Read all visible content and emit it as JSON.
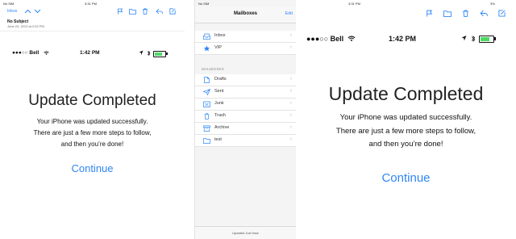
{
  "left_panel": {
    "status": {
      "carrier": "No SIM",
      "time": "3:31 PM"
    },
    "toolbar": {
      "back_label": "Inbox"
    },
    "message": {
      "subject": "No Subject",
      "date": "June 24, 2013 at 2:02 PM"
    },
    "device": {
      "carrier": "●●●○○ Bell",
      "time": "1:42 PM",
      "title": "Update Completed",
      "body_lines": [
        "Your iPhone was updated successfully.",
        "There are just a few more steps to follow,",
        "and then you’re done!"
      ],
      "continue_label": "Continue"
    }
  },
  "middle_panel": {
    "status": {
      "carrier": "No SIM"
    },
    "header": {
      "title": "Mailboxes",
      "edit_label": "Edit"
    },
    "top_items": [
      {
        "label": "Inbox",
        "icon": "inbox-icon"
      },
      {
        "label": "VIP",
        "icon": "star-icon"
      }
    ],
    "section_label": "MAILBOXES",
    "mailbox_items": [
      {
        "label": "Drafts",
        "icon": "drafts-icon"
      },
      {
        "label": "Sent",
        "icon": "sent-icon"
      },
      {
        "label": "Junk",
        "icon": "junk-icon"
      },
      {
        "label": "Trash",
        "icon": "trash-icon"
      },
      {
        "label": "Archive",
        "icon": "archive-icon"
      },
      {
        "label": "test",
        "icon": "folder-icon"
      }
    ],
    "footer": "Updated Just Now"
  },
  "right_panel": {
    "status": {
      "time": "3:31 PM",
      "battery": "3%"
    },
    "device": {
      "carrier": "●●●○○ Bell",
      "time": "1:42 PM",
      "title": "Update Completed",
      "body_lines": [
        "Your iPhone was updated successfully.",
        "There are just a few more steps to follow,",
        "and then you’re done!"
      ],
      "continue_label": "Continue"
    }
  },
  "colors": {
    "accent": "#2f86f6",
    "text": "#1a1a1a",
    "battery": "#4cd964"
  }
}
